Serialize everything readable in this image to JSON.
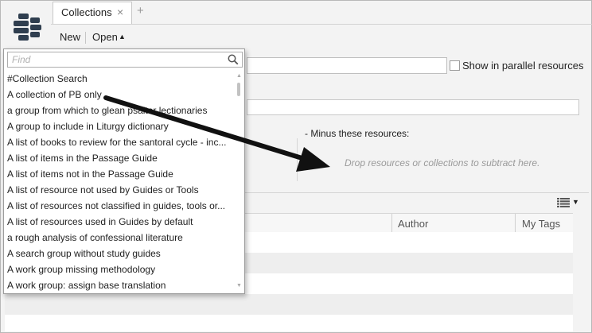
{
  "tab": {
    "label": "Collections",
    "close_glyph": "×",
    "add_glyph": "+"
  },
  "toolbar": {
    "new_label": "New",
    "open_label": "Open",
    "open_caret": "▲"
  },
  "find": {
    "placeholder": "Find",
    "value": ""
  },
  "dropdown_items": [
    "#Collection Search",
    "A collection of PB only",
    "a group from which to glean psalter lectionaries",
    "A group to include in Liturgy dictionary",
    "A list of books to review for the santoral cycle - inc...",
    "A list of items in the Passage Guide",
    "A list of items not in the Passage Guide",
    "A list of resource not used by Guides or Tools",
    "A list of resources not classified in guides, tools or...",
    "A list of resources used in Guides by default",
    "a rough analysis of confessional literature",
    "A search group without study guides",
    "A work group missing methodology",
    "A work group: assign base translation"
  ],
  "form": {
    "parallel_label": "Show in parallel resources",
    "minus_label": "-  Minus these resources:",
    "drop_hint": "Drop resources or collections to subtract here."
  },
  "table": {
    "col_author": "Author",
    "col_tags": "My Tags"
  },
  "icons": {
    "logo": "library-logo-icon",
    "search": "search-icon",
    "view": "view-options-icon",
    "arrow": "annotation-arrow"
  },
  "colors": {
    "panel_bg": "#f3f3f3",
    "border": "#b8b8b8",
    "logo": "#2f3e4f",
    "arrow": "#111111",
    "hint_text": "#9a9a9a"
  }
}
